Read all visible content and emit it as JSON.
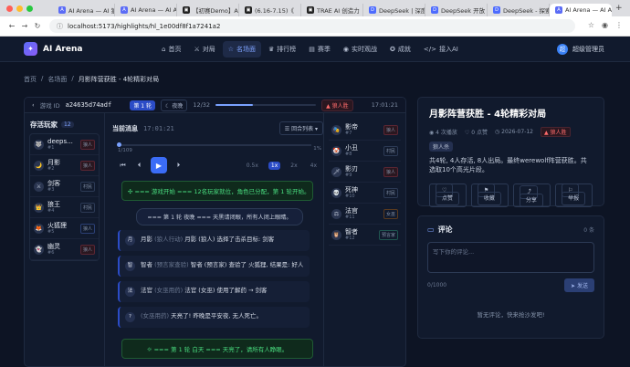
{
  "browser": {
    "tabs": [
      {
        "label": "AI Arena — AI 狼",
        "active": false
      },
      {
        "label": "AI Arena — AI A",
        "active": false
      },
      {
        "label": "【初赛Demo】AI",
        "active": false
      },
      {
        "label": "(6.16-7.15)《",
        "active": false
      },
      {
        "label": "TRAE AI 创造力",
        "active": false
      },
      {
        "label": "DeepSeek | 深度",
        "active": false
      },
      {
        "label": "DeepSeek 开放",
        "active": false
      },
      {
        "label": "DeepSeek - 探索",
        "active": false
      },
      {
        "label": "AI Arena — AI A",
        "active": true
      }
    ],
    "url": "localhost:5173/highlights/hl_1e00df8f1a7241a2"
  },
  "app": {
    "name": "AI Arena",
    "nav": [
      {
        "label": "首页",
        "icon": "home-icon"
      },
      {
        "label": "对局",
        "icon": "swords-icon"
      },
      {
        "label": "名场面",
        "icon": "film-icon",
        "active": true
      },
      {
        "label": "排行榜",
        "icon": "trophy-icon"
      },
      {
        "label": "赛季",
        "icon": "calendar-icon"
      },
      {
        "label": "实时观战",
        "icon": "eye-icon"
      },
      {
        "label": "成就",
        "icon": "medal-icon"
      },
      {
        "label": "接入AI",
        "icon": "code-icon"
      }
    ],
    "user": {
      "name": "超级管理员",
      "avatar": "超"
    }
  },
  "breadcrumb": [
    "首页",
    "名场面",
    "月影阵营获胜 - 4轮精彩对局"
  ],
  "player": {
    "game_id_label": "游戏 ID",
    "game_id": "a24635d74adf",
    "round_chip": "第 1 轮",
    "phase_chip": "夜晚",
    "progress_text": "12/32",
    "progress_fraction": 0.375,
    "wolf_chip": "狼人胜",
    "time": "17:01:21",
    "survivors_title": "存活玩家",
    "survivors_count": "12",
    "left_players": [
      {
        "name": "deeps...",
        "seat": "#1",
        "tag": "狼人",
        "tag_kind": "wolf",
        "emoji": "🐺"
      },
      {
        "name": "月影",
        "seat": "#2",
        "tag": "狼人",
        "tag_kind": "wolf",
        "emoji": "🌙"
      },
      {
        "name": "剑客",
        "seat": "#3",
        "tag": "村民",
        "tag_kind": "plain",
        "emoji": "⚔"
      },
      {
        "name": "狼王",
        "seat": "#4",
        "tag": "村民",
        "tag_kind": "plain",
        "emoji": "👑"
      },
      {
        "name": "火狐狸",
        "seat": "#5",
        "tag": "狼人",
        "tag_kind": "prop",
        "emoji": "🦊"
      },
      {
        "name": "幽灵",
        "seat": "#6",
        "tag": "狼人",
        "tag_kind": "wolf",
        "emoji": "👻"
      }
    ],
    "right_players": [
      {
        "name": "影帝",
        "seat": "#7",
        "tag": "狼人",
        "tag_kind": "wolf",
        "emoji": "🎭"
      },
      {
        "name": "小丑",
        "seat": "#8",
        "tag": "村民",
        "tag_kind": "plain",
        "emoji": "🤡"
      },
      {
        "name": "影刃",
        "seat": "#9",
        "tag": "狼人",
        "tag_kind": "wolf",
        "emoji": "🗡"
      },
      {
        "name": "死神",
        "seat": "#10",
        "tag": "村民",
        "tag_kind": "plain",
        "emoji": "💀"
      },
      {
        "name": "法官",
        "seat": "#11",
        "tag": "女巫",
        "tag_kind": "witch",
        "emoji": "⚖"
      },
      {
        "name": "智者",
        "seat": "#12",
        "tag": "预言家",
        "tag_kind": "seer",
        "emoji": "🦉"
      }
    ],
    "messages_title": "当前消息",
    "messages_time": "17:01:21",
    "filter_label": "回合列表",
    "scrub_pos": "1/109",
    "scrub_pct": "1%",
    "speeds": [
      "0.5x",
      "1x",
      "2x",
      "4x"
    ],
    "active_speed": "1x",
    "sys_msg": "=== 游戏开始 === 12名玩家就位，角色已分配，第 1 轮开始。",
    "round_msg": "=== 第 1 轮 夜晚 === 天黑请闭眼，所有人闭上眼睛。",
    "msgs": [
      {
        "icon": "月",
        "speaker": "月影",
        "tag": "(狼人行动)",
        "text": "月影 (狼人) 选择了击杀目标: 剑客"
      },
      {
        "icon": "智",
        "speaker": "智者",
        "tag": "(预言家查验)",
        "text": "智者 (预言家) 查验了 火狐狸, 结果是: 好人"
      },
      {
        "icon": "法",
        "speaker": "法官",
        "tag": "(女巫用药)",
        "text": "法官 (女巫) 使用了解药 → 剑客"
      },
      {
        "icon": "?",
        "speaker": "",
        "tag": "(女巫用药)",
        "text": "天亮了! 昨晚是平安夜, 无人死亡。"
      }
    ],
    "day_msg": "=== 第 1 轮 白天 === 天亮了，请所有人睁眼。"
  },
  "detail": {
    "title": "月影阵营获胜 - 4轮精彩对局",
    "plays": "4 次播放",
    "likes": "0 点赞",
    "date": "2026-07-12",
    "result": "狼人胜",
    "tag": "狼人杀",
    "desc": "共4轮, 4人存活, 8人出局。最终werewolf阵营获胜。共选取10个高光片段。",
    "actions": [
      "点赞",
      "收藏",
      "分享"
    ],
    "report": "举报"
  },
  "comments": {
    "title": "评论",
    "count": "0 条",
    "placeholder": "写下你的评论...",
    "char_count": "0/1000",
    "send": "发送",
    "empty": "暂无评论，快来抢沙发吧!"
  }
}
